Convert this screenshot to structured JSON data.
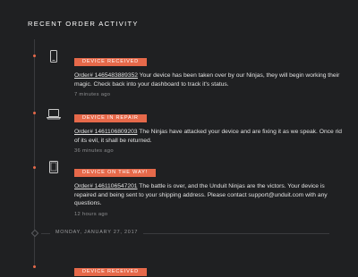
{
  "header": {
    "title": "RECENT ORDER ACTIVITY"
  },
  "entries": [
    {
      "device": "phone-icon",
      "badge": "DEVICE RECEIVED",
      "order": "Order# 1465483889352",
      "message": " Your device has been taken over by our Ninjas, they will begin working their magic. Check back into your dashboard to track it's status.",
      "time": "7 minutes ago"
    },
    {
      "device": "laptop-icon",
      "badge": "DEVICE IN REPAIR",
      "order": "Order# 1461106809203",
      "message": " The Ninjas have attacked your device and are fixing it as we speak. Once rid of its evil, it shall be returned.",
      "time": "36 minutes ago"
    },
    {
      "device": "tablet-icon",
      "badge": "DEVICE ON THE WAY!",
      "order": "Order# 1461106547201",
      "message": " The battle is over, and the Unduit Ninjas are the victors. Your device is repaired and being sent to your shipping address. Please contact support@unduit.com with any questions.",
      "time": "12 hours ago"
    },
    {
      "badge": "DEVICE RECEIVED"
    }
  ],
  "date_divider": "MONDAY, JANUARY 27, 2017",
  "colors": {
    "accent": "#e6694a",
    "background": "#1f2022"
  }
}
